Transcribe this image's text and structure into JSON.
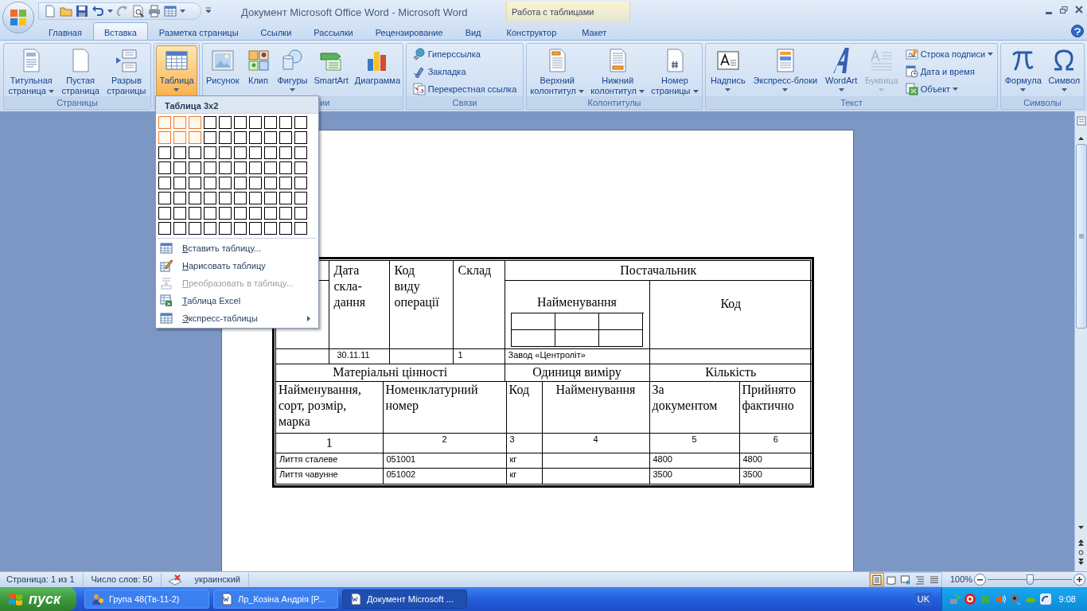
{
  "window": {
    "title": "Документ Microsoft Office Word - Microsoft Word",
    "contextual_group": "Работа с таблицами"
  },
  "tabs": [
    {
      "label": "Главная",
      "selected": false,
      "kind": "main"
    },
    {
      "label": "Вставка",
      "selected": true,
      "kind": "main"
    },
    {
      "label": "Разметка страницы",
      "selected": false,
      "kind": "main"
    },
    {
      "label": "Ссылки",
      "selected": false,
      "kind": "main"
    },
    {
      "label": "Рассылки",
      "selected": false,
      "kind": "main"
    },
    {
      "label": "Рецензирование",
      "selected": false,
      "kind": "main"
    },
    {
      "label": "Вид",
      "selected": false,
      "kind": "main"
    },
    {
      "label": "Конструктор",
      "selected": false,
      "kind": "contextual"
    },
    {
      "label": "Макет",
      "selected": false,
      "kind": "contextual"
    }
  ],
  "ribbon": {
    "groups": [
      {
        "label": "Страницы",
        "items": [
          {
            "kind": "large",
            "label": "Титульная\nстраница",
            "dropdown": true,
            "pressed": false,
            "disabled": false
          },
          {
            "kind": "large",
            "label": "Пустая\nстраница",
            "dropdown": false,
            "pressed": false,
            "disabled": false
          },
          {
            "kind": "large",
            "label": "Разрыв\nстраницы",
            "dropdown": false,
            "pressed": false,
            "disabled": false
          }
        ]
      },
      {
        "items": [
          {
            "kind": "large",
            "label": "Таблица",
            "dropdown": true,
            "pressed": true,
            "disabled": false
          }
        ]
      },
      {
        "label": "ии",
        "items": [
          {
            "kind": "large",
            "label": "Рисунок",
            "dropdown": false,
            "pressed": false,
            "disabled": false
          },
          {
            "kind": "large",
            "label": "Клип",
            "dropdown": false,
            "pressed": false,
            "disabled": false
          },
          {
            "kind": "large",
            "label": "Фигуры",
            "dropdown": true,
            "pressed": false,
            "disabled": false
          },
          {
            "kind": "large",
            "label": "SmartArt",
            "dropdown": false,
            "pressed": false,
            "disabled": false
          },
          {
            "kind": "large",
            "label": "Диаграмма",
            "dropdown": false,
            "pressed": false,
            "disabled": false
          }
        ]
      },
      {
        "label": "Связи",
        "items": [
          {
            "kind": "small",
            "label": "Гиперссылка",
            "dropdown": false,
            "pressed": false,
            "disabled": false
          },
          {
            "kind": "small",
            "label": "Закладка",
            "dropdown": false,
            "pressed": false,
            "disabled": false
          },
          {
            "kind": "small",
            "label": "Перекрестная ссылка",
            "dropdown": false,
            "pressed": false,
            "disabled": false
          }
        ]
      },
      {
        "label": "Колонтитулы",
        "items": [
          {
            "kind": "large",
            "label": "Верхний\nколонтитул",
            "dropdown": true,
            "pressed": false,
            "disabled": false
          },
          {
            "kind": "large",
            "label": "Нижний\nколонтитул",
            "dropdown": true,
            "pressed": false,
            "disabled": false
          },
          {
            "kind": "large",
            "label": "Номер\nстраницы",
            "dropdown": true,
            "pressed": false,
            "disabled": false
          }
        ]
      },
      {
        "label": "Текст",
        "items": [
          {
            "kind": "large",
            "label": "Надпись",
            "dropdown": true,
            "pressed": false,
            "disabled": false
          },
          {
            "kind": "large",
            "label": "Экспресс-блоки",
            "dropdown": true,
            "pressed": false,
            "disabled": false
          },
          {
            "kind": "large",
            "label": "WordArt",
            "dropdown": true,
            "pressed": false,
            "disabled": false
          },
          {
            "kind": "large",
            "label": "Буквица",
            "dropdown": true,
            "pressed": false,
            "disabled": true
          },
          {
            "kind": "small",
            "label": "Строка подписи",
            "dropdown": true,
            "pressed": false,
            "disabled": false
          },
          {
            "kind": "small",
            "label": "Дата и время",
            "dropdown": false,
            "pressed": false,
            "disabled": false
          },
          {
            "kind": "small",
            "label": "Объект",
            "dropdown": true,
            "pressed": false,
            "disabled": false
          }
        ]
      },
      {
        "label": "Символы",
        "items": [
          {
            "kind": "large",
            "label": "Формула",
            "dropdown": true,
            "pressed": false,
            "disabled": false
          },
          {
            "kind": "large",
            "label": "Символ",
            "dropdown": true,
            "pressed": false,
            "disabled": false
          }
        ]
      }
    ]
  },
  "table_menu": {
    "title": "Таблица 3x2",
    "grid": [
      {
        "cells": [
          {
            "selected": true
          },
          {
            "selected": true
          },
          {
            "selected": true
          },
          {
            "selected": false
          },
          {
            "selected": false
          },
          {
            "selected": false
          },
          {
            "selected": false
          },
          {
            "selected": false
          },
          {
            "selected": false
          },
          {
            "selected": false
          }
        ]
      },
      {
        "cells": [
          {
            "selected": true
          },
          {
            "selected": true
          },
          {
            "selected": true
          },
          {
            "selected": false
          },
          {
            "selected": false
          },
          {
            "selected": false
          },
          {
            "selected": false
          },
          {
            "selected": false
          },
          {
            "selected": false
          },
          {
            "selected": false
          }
        ]
      },
      {
        "cells": [
          {
            "selected": false
          },
          {
            "selected": false
          },
          {
            "selected": false
          },
          {
            "selected": false
          },
          {
            "selected": false
          },
          {
            "selected": false
          },
          {
            "selected": false
          },
          {
            "selected": false
          },
          {
            "selected": false
          },
          {
            "selected": false
          }
        ]
      },
      {
        "cells": [
          {
            "selected": false
          },
          {
            "selected": false
          },
          {
            "selected": false
          },
          {
            "selected": false
          },
          {
            "selected": false
          },
          {
            "selected": false
          },
          {
            "selected": false
          },
          {
            "selected": false
          },
          {
            "selected": false
          },
          {
            "selected": false
          }
        ]
      },
      {
        "cells": [
          {
            "selected": false
          },
          {
            "selected": false
          },
          {
            "selected": false
          },
          {
            "selected": false
          },
          {
            "selected": false
          },
          {
            "selected": false
          },
          {
            "selected": false
          },
          {
            "selected": false
          },
          {
            "selected": false
          },
          {
            "selected": false
          }
        ]
      },
      {
        "cells": [
          {
            "selected": false
          },
          {
            "selected": false
          },
          {
            "selected": false
          },
          {
            "selected": false
          },
          {
            "selected": false
          },
          {
            "selected": false
          },
          {
            "selected": false
          },
          {
            "selected": false
          },
          {
            "selected": false
          },
          {
            "selected": false
          }
        ]
      },
      {
        "cells": [
          {
            "selected": false
          },
          {
            "selected": false
          },
          {
            "selected": false
          },
          {
            "selected": false
          },
          {
            "selected": false
          },
          {
            "selected": false
          },
          {
            "selected": false
          },
          {
            "selected": false
          },
          {
            "selected": false
          },
          {
            "selected": false
          }
        ]
      },
      {
        "cells": [
          {
            "selected": false
          },
          {
            "selected": false
          },
          {
            "selected": false
          },
          {
            "selected": false
          },
          {
            "selected": false
          },
          {
            "selected": false
          },
          {
            "selected": false
          },
          {
            "selected": false
          },
          {
            "selected": false
          },
          {
            "selected": false
          }
        ]
      }
    ],
    "items": [
      {
        "label": "Вставить таблицу...",
        "disabled": false,
        "submenu": false
      },
      {
        "label": "Нарисовать таблицу",
        "disabled": false,
        "submenu": false
      },
      {
        "label": "Преобразовать в таблицу...",
        "disabled": true,
        "submenu": false
      },
      {
        "label": "Таблица Excel",
        "disabled": false,
        "submenu": false
      },
      {
        "label": "Экспресс-таблицы",
        "disabled": false,
        "submenu": true
      }
    ]
  },
  "document_table": {
    "top_headers": [
      "Дата\nскла-\nдання",
      "Код\nвиду\nоперації",
      "Склад"
    ],
    "supplier": {
      "title": "Постачальник",
      "name_header": "Найменування",
      "code_header": "Код"
    },
    "entry": {
      "date": "30.11.11",
      "warehouse": "1",
      "supplier_name": "Завод «Центроліт»"
    },
    "sections": [
      "Матеріальні цінності",
      "Одиниця виміру",
      "Кількість"
    ],
    "columns": [
      "Найменування,\nсорт, розмір,\nмарка",
      "Номенклатурний\nномер",
      "Код",
      "Найменування",
      "За\nдокументом",
      "Прийнято\nфактично"
    ],
    "column_numbers": [
      "1",
      "2",
      "3",
      "4",
      "5",
      "6"
    ],
    "rows": [
      {
        "name": "Лиття сталеве",
        "number": "051001",
        "unit": "кг",
        "by_document": "4800",
        "actual": "4800"
      },
      {
        "name": "Лиття чавунне",
        "number": "051002",
        "unit": "кг",
        "by_document": "3500",
        "actual": "3500"
      }
    ]
  },
  "status_bar": {
    "page": "Страница: 1 из 1",
    "words": "Число слов: 50",
    "language": "украинский",
    "views": [
      {
        "selected": true
      },
      {
        "selected": false
      },
      {
        "selected": false
      },
      {
        "selected": false
      },
      {
        "selected": false
      }
    ],
    "zoom": {
      "reading": "100%",
      "level": 0.5
    }
  },
  "taskbar": {
    "start": "пуск",
    "tasks": [
      {
        "label": "Група 48(Тв-11-2)",
        "selected": false
      },
      {
        "label": "Лр_Козіна Андрія [Р...",
        "selected": false
      },
      {
        "label": "Документ Microsoft ...",
        "selected": true
      }
    ],
    "language": "UK",
    "clock": "9:08"
  }
}
